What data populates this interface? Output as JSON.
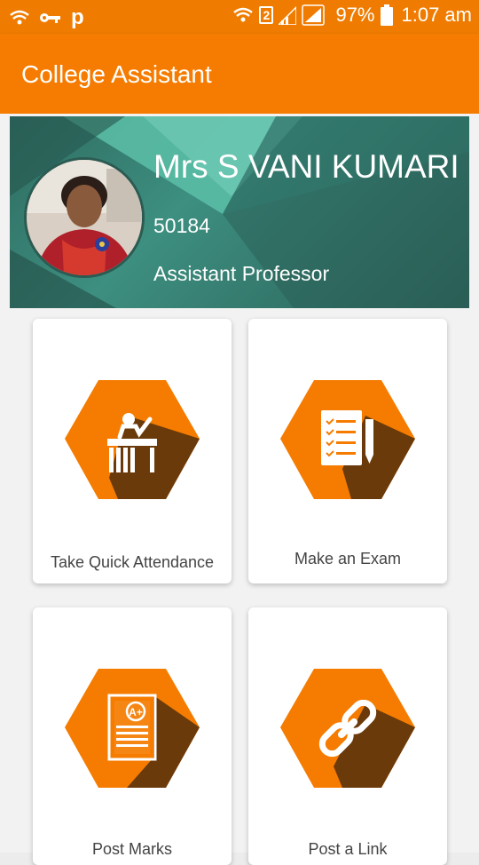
{
  "status_bar": {
    "battery": "97%",
    "time": "1:07 am",
    "sim": "2",
    "app_letter": "p"
  },
  "app": {
    "title": "College Assistant",
    "accent": "#f57c00"
  },
  "profile": {
    "name": "Mrs S VANI KUMARI",
    "id": "50184",
    "role": "Assistant Professor"
  },
  "tiles": [
    {
      "label": "Take Quick Attendance",
      "icon": "attendance-icon"
    },
    {
      "label": "Make an Exam",
      "icon": "checklist-icon"
    },
    {
      "label": "Post Marks",
      "icon": "marks-icon"
    },
    {
      "label": "Post a Link",
      "icon": "link-icon"
    }
  ]
}
